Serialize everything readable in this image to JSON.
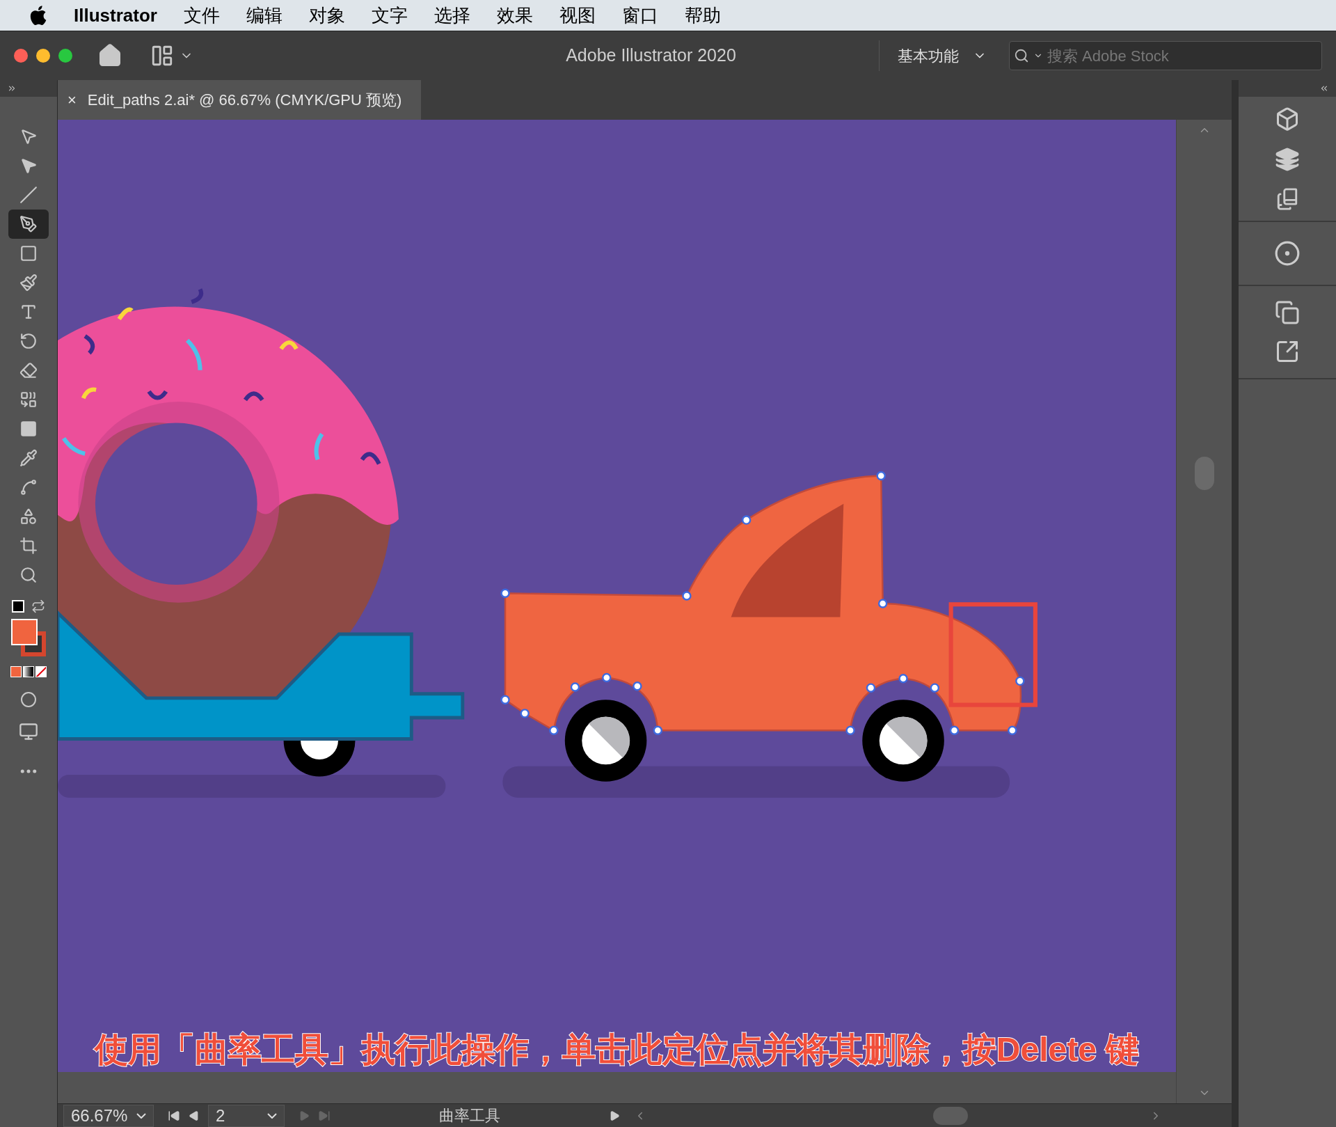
{
  "menu_bar": {
    "app_name": "Illustrator",
    "items": [
      "文件",
      "编辑",
      "对象",
      "文字",
      "选择",
      "效果",
      "视图",
      "窗口",
      "帮助"
    ]
  },
  "title_bar": {
    "title": "Adobe Illustrator 2020",
    "workspace": "基本功能",
    "search": {
      "placeholder": "搜索 Adobe Stock"
    }
  },
  "document_tab": {
    "close": "×",
    "title": "Edit_paths 2.ai* @ 66.67% (CMYK/GPU 预览)"
  },
  "tools": [
    {
      "kind": "select",
      "selected": false
    },
    {
      "kind": "direct",
      "selected": false
    },
    {
      "kind": "line",
      "selected": false
    },
    {
      "kind": "curvature",
      "selected": true
    },
    {
      "kind": "rect",
      "selected": false
    },
    {
      "kind": "brush",
      "selected": false
    },
    {
      "kind": "type",
      "selected": false
    },
    {
      "kind": "rotate",
      "selected": false
    },
    {
      "kind": "eraser",
      "selected": false
    },
    {
      "kind": "builder",
      "selected": false
    },
    {
      "kind": "gradient",
      "selected": false
    },
    {
      "kind": "eyedropper",
      "selected": false
    },
    {
      "kind": "puppet",
      "selected": false
    },
    {
      "kind": "shapes",
      "selected": false
    },
    {
      "kind": "artboard",
      "selected": false
    },
    {
      "kind": "zoom",
      "selected": false
    }
  ],
  "caption": "使用「曲率工具」执行此操作，单击此定位点并将其删除，按Delete 键",
  "status_bar": {
    "zoom": "66.67%",
    "artboard": "2",
    "current_tool": "曲率工具"
  }
}
